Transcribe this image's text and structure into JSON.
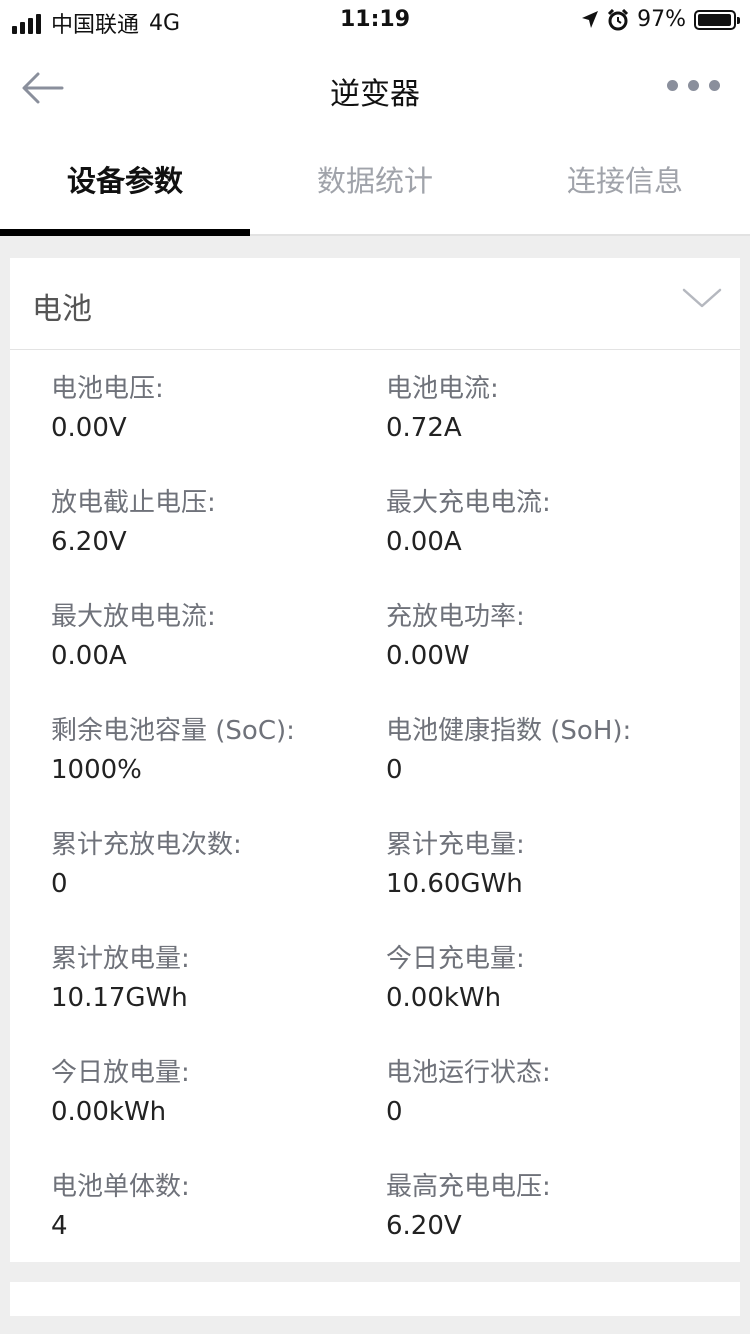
{
  "status_bar": {
    "carrier": "中国联通",
    "network": "4G",
    "time": "11:19",
    "battery_percent_label": "97%",
    "battery_level": 0.97
  },
  "nav": {
    "title": "逆变器"
  },
  "tabs": [
    {
      "label": "设备参数",
      "active": true
    },
    {
      "label": "数据统计",
      "active": false
    },
    {
      "label": "连接信息",
      "active": false
    }
  ],
  "battery_section": {
    "title": "电池",
    "fields": [
      {
        "label": "电池电压:",
        "value": "0.00V"
      },
      {
        "label": "电池电流:",
        "value": "0.72A"
      },
      {
        "label": "放电截止电压:",
        "value": "6.20V"
      },
      {
        "label": "最大充电电流:",
        "value": "0.00A"
      },
      {
        "label": "最大放电电流:",
        "value": "0.00A"
      },
      {
        "label": "充放电功率:",
        "value": "0.00W"
      },
      {
        "label": "剩余电池容量 (SoC):",
        "value": "1000%"
      },
      {
        "label": "电池健康指数 (SoH):",
        "value": "0"
      },
      {
        "label": "累计充放电次数:",
        "value": "0"
      },
      {
        "label": "累计充电量:",
        "value": "10.60GWh"
      },
      {
        "label": "累计放电量:",
        "value": "10.17GWh"
      },
      {
        "label": "今日充电量:",
        "value": "0.00kWh"
      },
      {
        "label": "今日放电量:",
        "value": "0.00kWh"
      },
      {
        "label": "电池运行状态:",
        "value": "0"
      },
      {
        "label": "电池单体数:",
        "value": "4"
      },
      {
        "label": "最高充电电压:",
        "value": "6.20V"
      }
    ]
  },
  "colors": {
    "background": "#eeeeee",
    "active_tab": "#000000",
    "inactive_tab": "#a0a3aa",
    "label": "#6f727a"
  }
}
